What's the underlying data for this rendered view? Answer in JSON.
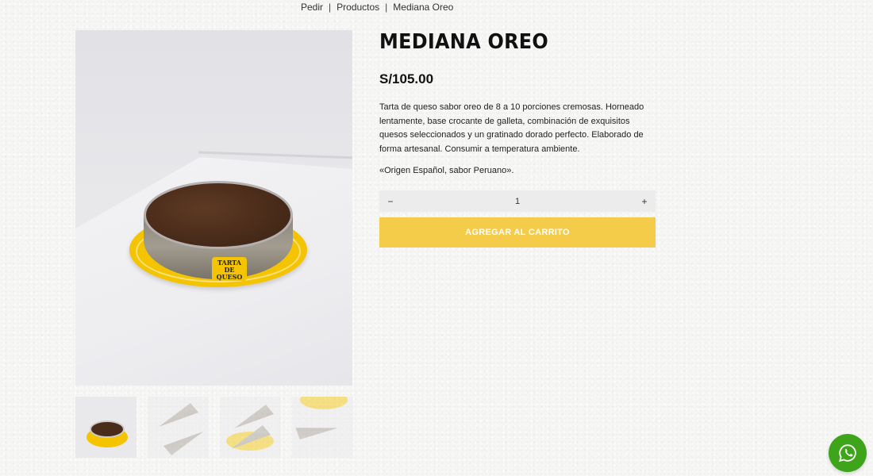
{
  "breadcrumb": {
    "items": [
      "Pedir",
      "Productos",
      "Mediana Oreo"
    ],
    "separator": "|"
  },
  "product": {
    "title": "MEDIANA OREO",
    "price": "S/105.00",
    "description": "Tarta de queso sabor oreo de 8 a 10 porciones cremosas. Horneado lentamente, base crocante de galleta, combinación de exquisitos quesos seleccionados y un gratinado dorado perfecto. Elaborado de forma artesanal. Consumir a temperatura ambiente.",
    "tagline": "«Origen Español, sabor Peruano».",
    "cake_label": "TARTA DE QUESO"
  },
  "quantity": {
    "minus": "−",
    "value": "1",
    "plus": "+"
  },
  "cart": {
    "add_label": "AGREGAR AL CARRITO"
  },
  "gallery": {
    "thumbnail_count": 4,
    "active_index": 0
  },
  "colors": {
    "accent": "#f5cc4a",
    "whatsapp": "#3ea51a",
    "plate_yellow": "#f5c400"
  },
  "icons": {
    "whatsapp": "whatsapp-icon"
  }
}
